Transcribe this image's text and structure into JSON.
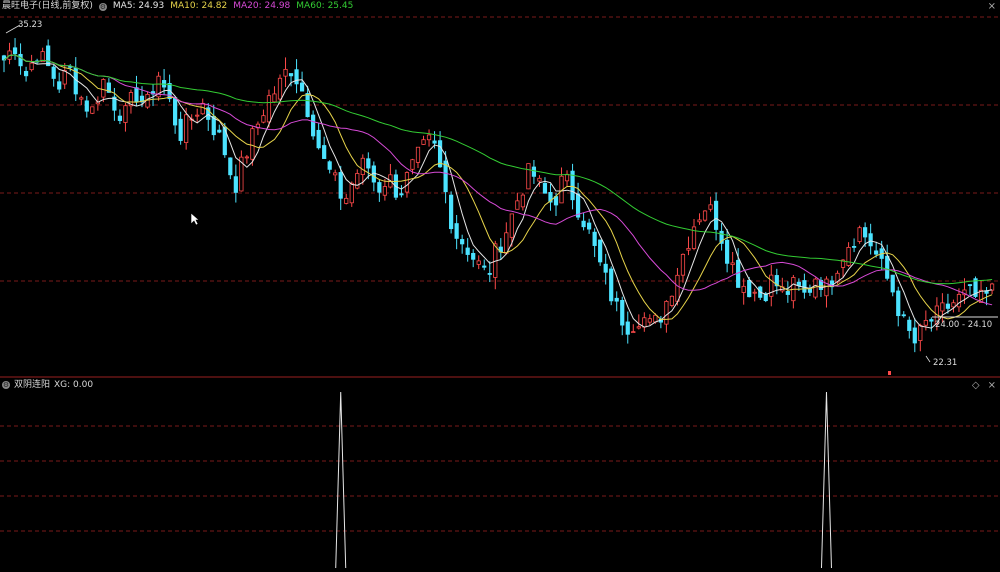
{
  "header": {
    "title": "晨旺电子(日线,前复权)",
    "ma5_label": "MA5: 24.93",
    "ma10_label": "MA10: 24.82",
    "ma20_label": "MA20: 24.98",
    "ma60_label": "MA60: 25.45"
  },
  "colors": {
    "up": "#ff4a4a",
    "down": "#4ce3ff",
    "ma5": "#e6e6e6",
    "ma10": "#e6d34a",
    "ma20": "#d64ad6",
    "ma60": "#33cc33",
    "grid": "#7a1a1a"
  },
  "annotations": {
    "high_price": "35.23",
    "range_label": "24.00 - 24.10",
    "low_price": "22.31"
  },
  "indicator": {
    "name": "双阴连阳",
    "value_label": "XG: 0.00",
    "signal_bar_index": [
      61,
      149
    ]
  },
  "controls": {
    "settings_icon": "gear-icon",
    "minimize_icon": "diamond-icon",
    "close_icon": "close-icon"
  },
  "chart_data": {
    "type": "candlestick",
    "title": "晨旺电子(日线,前复权)",
    "ylim": [
      21.5,
      36
    ],
    "series_names": [
      "MA5",
      "MA10",
      "MA20",
      "MA60"
    ],
    "candles_anchor_closes": [
      34.2,
      34.8,
      33.6,
      34.5,
      33.9,
      33.2,
      33.8,
      32.7,
      32.1,
      33.4,
      32.5,
      31.9,
      32.9,
      32.3,
      33.7,
      32.6,
      31.2,
      31.8,
      32.5,
      31.6,
      30.7,
      29.1,
      30.4,
      31.5,
      32.6,
      33.1,
      34.0,
      33.2,
      31.8,
      30.2,
      29.4,
      28.5,
      29.6,
      30.1,
      29.0,
      29.5,
      28.8,
      29.7,
      30.5,
      31.0,
      29.3,
      27.3,
      26.8,
      26.1,
      25.5,
      26.7,
      27.6,
      28.9,
      29.8,
      28.9,
      28.4,
      29.5,
      28.6,
      27.6,
      26.3,
      25.1,
      24.0,
      23.5,
      24.0,
      23.4,
      24.1,
      25.3,
      26.6,
      27.8,
      28.4,
      27.6,
      26.3,
      25.3,
      25.0,
      24.7,
      25.4,
      24.8,
      25.1,
      24.7,
      25.6,
      25.0,
      26.1,
      26.9,
      27.4,
      26.8,
      25.8,
      24.9,
      23.5,
      22.8,
      23.6,
      23.9,
      24.3,
      24.6,
      24.8,
      24.5,
      24.9
    ]
  }
}
